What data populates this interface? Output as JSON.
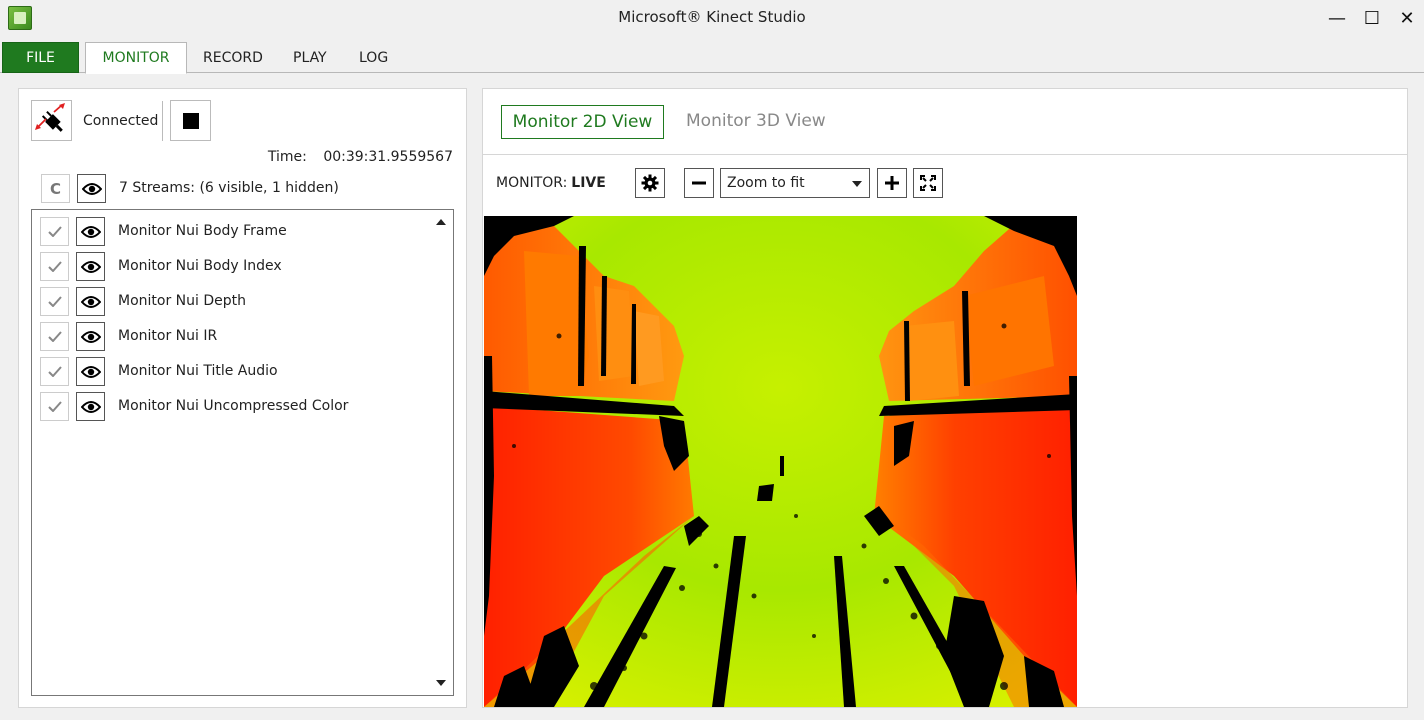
{
  "window": {
    "title": "Microsoft® Kinect Studio",
    "minimize_glyph": "—",
    "maximize_glyph": "☐",
    "close_glyph": "✕"
  },
  "tabs": [
    {
      "label": "FILE"
    },
    {
      "label": "MONITOR"
    },
    {
      "label": "RECORD"
    },
    {
      "label": "PLAY"
    },
    {
      "label": "LOG"
    }
  ],
  "left": {
    "status": "Connected",
    "time_label": "Time:",
    "time_value": "00:39:31.9559567",
    "c_button": "C",
    "streams_summary": "7 Streams: (6 visible, 1 hidden)",
    "streams": [
      {
        "name": "Monitor Nui Body Frame",
        "checked": true,
        "visible": true
      },
      {
        "name": "Monitor Nui Body Index",
        "checked": true,
        "visible": true
      },
      {
        "name": "Monitor Nui Depth",
        "checked": true,
        "visible": true
      },
      {
        "name": "Monitor Nui IR",
        "checked": true,
        "visible": true
      },
      {
        "name": "Monitor Nui Title Audio",
        "checked": true,
        "visible": true
      },
      {
        "name": "Monitor Nui Uncompressed Color",
        "checked": true,
        "visible": true
      }
    ]
  },
  "right": {
    "view_tabs": [
      {
        "label": "Monitor 2D View",
        "active": true
      },
      {
        "label": "Monitor 3D View",
        "active": false
      }
    ],
    "monitor_label": "MONITOR:",
    "monitor_state": "LIVE",
    "zoom": {
      "selected": "Zoom to fit"
    }
  },
  "colors": {
    "accent_green": "#1f7a1f",
    "depth_near": "#ff2a00",
    "depth_mid": "#ff8c00",
    "depth_far": "#b8f000"
  }
}
